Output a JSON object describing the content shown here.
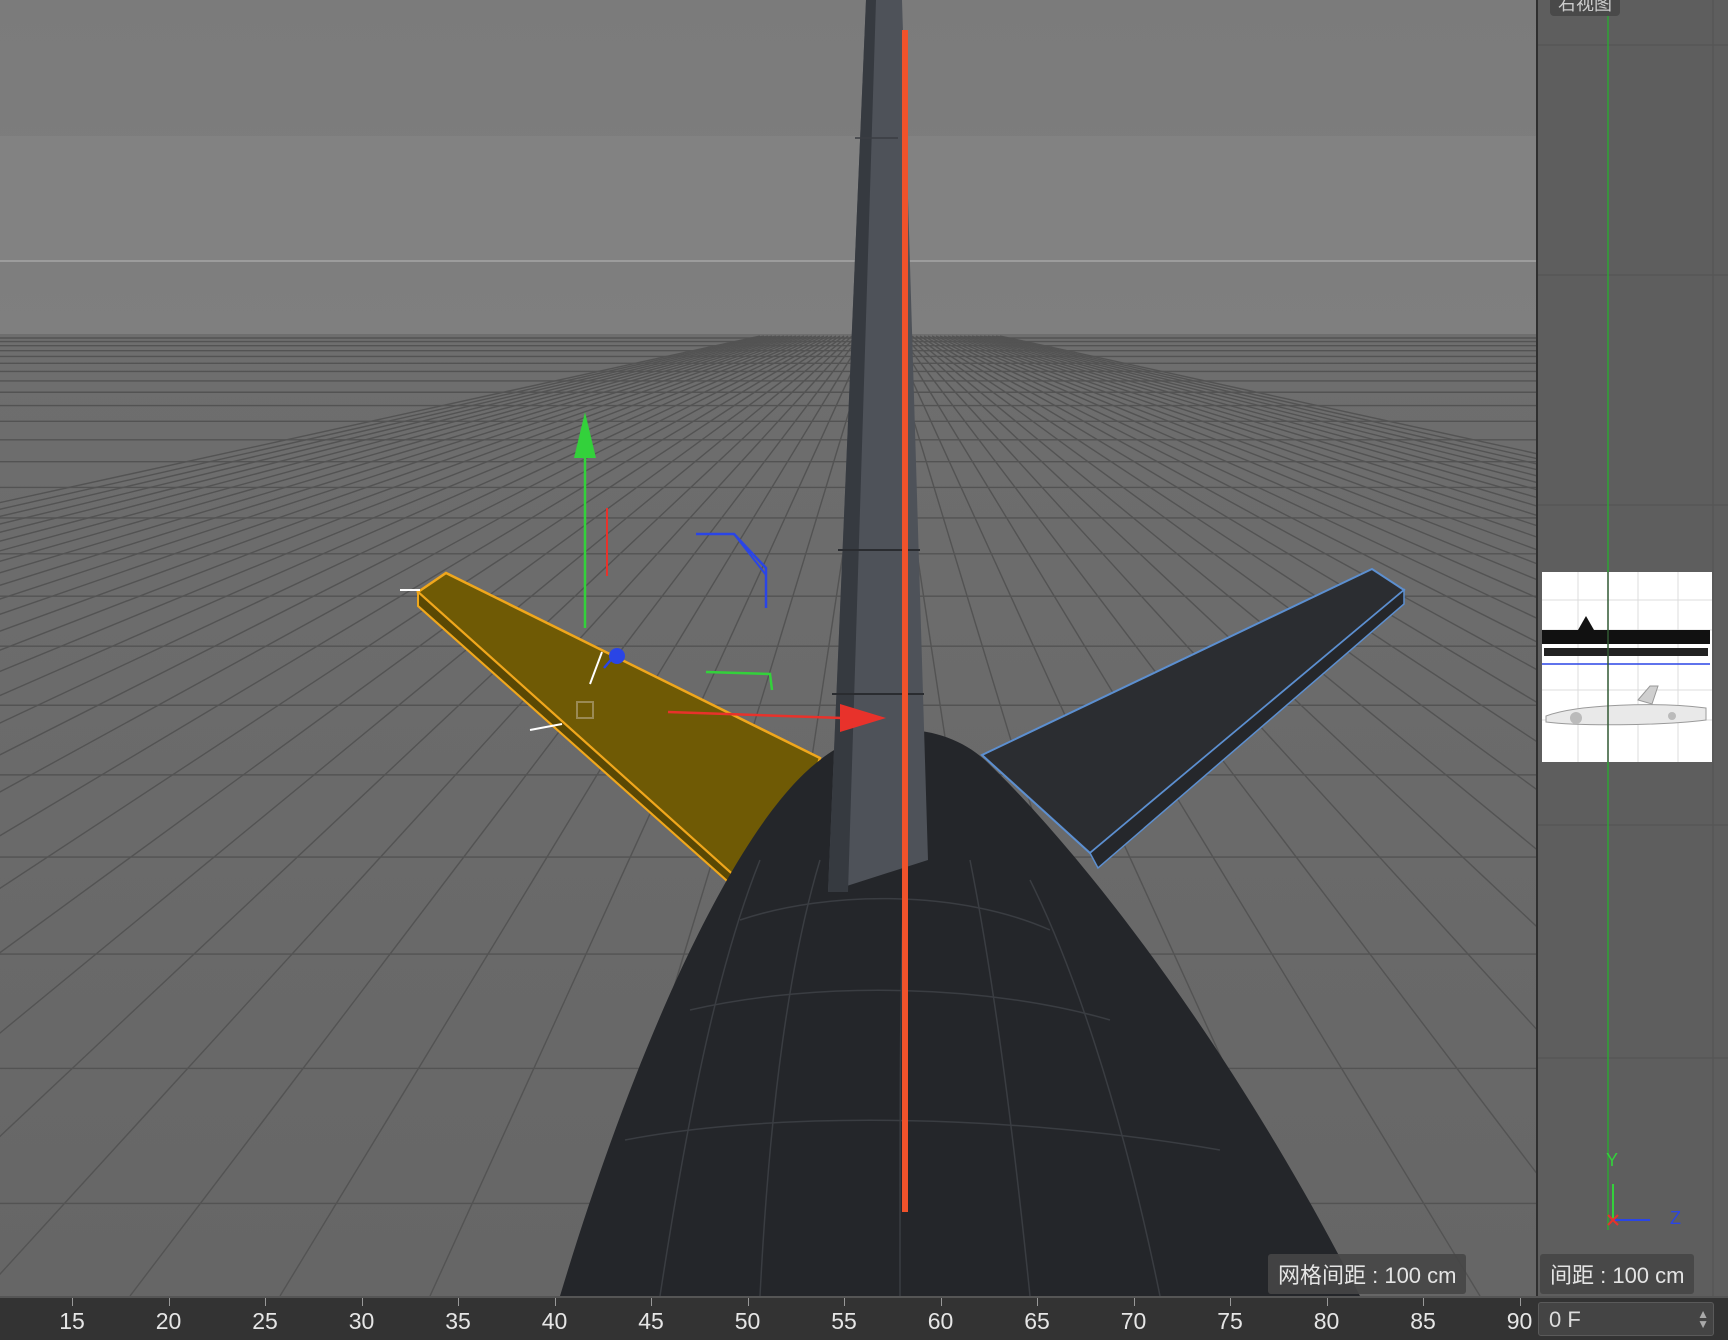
{
  "viewport": {
    "grid_spacing_label": "网格间距 : 100 cm",
    "gizmo_colors": {
      "x": "#e8322b",
      "y": "#33d13b",
      "z": "#2a45e6"
    },
    "selection_color": "#f0a71c"
  },
  "side_viewport": {
    "title": "右视图",
    "grid_spacing_label": "间距 : 100 cm",
    "axis_labels": {
      "y": "Y",
      "z": "Z"
    }
  },
  "timeline": {
    "ticks": [
      "15",
      "20",
      "25",
      "30",
      "35",
      "40",
      "45",
      "50",
      "55",
      "60",
      "65",
      "70",
      "75",
      "80",
      "85",
      "90"
    ],
    "current_frame": "0 F"
  }
}
